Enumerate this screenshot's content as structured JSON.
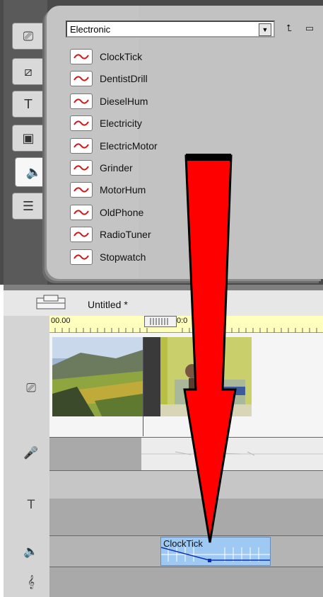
{
  "album": {
    "category": "Electronic",
    "sounds": [
      {
        "label": "ClockTick"
      },
      {
        "label": "DentistDrill"
      },
      {
        "label": "DieselHum"
      },
      {
        "label": "Electricity"
      },
      {
        "label": "ElectricMotor"
      },
      {
        "label": "Grinder"
      },
      {
        "label": "MotorHum"
      },
      {
        "label": "OldPhone"
      },
      {
        "label": "RadioTuner"
      },
      {
        "label": "Stopwatch"
      }
    ]
  },
  "side_tabs": [
    {
      "icon": "video-camera-icon"
    },
    {
      "icon": "transitions-icon"
    },
    {
      "icon": "titles-icon"
    },
    {
      "icon": "photos-icon"
    },
    {
      "icon": "sound-effects-icon",
      "active": true
    },
    {
      "icon": "disc-menus-icon"
    }
  ],
  "timeline": {
    "project_title": "Untitled *",
    "ruler": {
      "start": "00.00",
      "mid": "0:0"
    },
    "tracks": [
      "video-camera-icon",
      "microphone-icon",
      "title-track-icon",
      "speaker-icon",
      "music-note-icon"
    ],
    "soundfx_clip_label": "ClockTick"
  },
  "colors": {
    "ruler": "#ffffbe",
    "soundfx_clip": "#9ec9f2",
    "arrow": "#ff0000"
  }
}
